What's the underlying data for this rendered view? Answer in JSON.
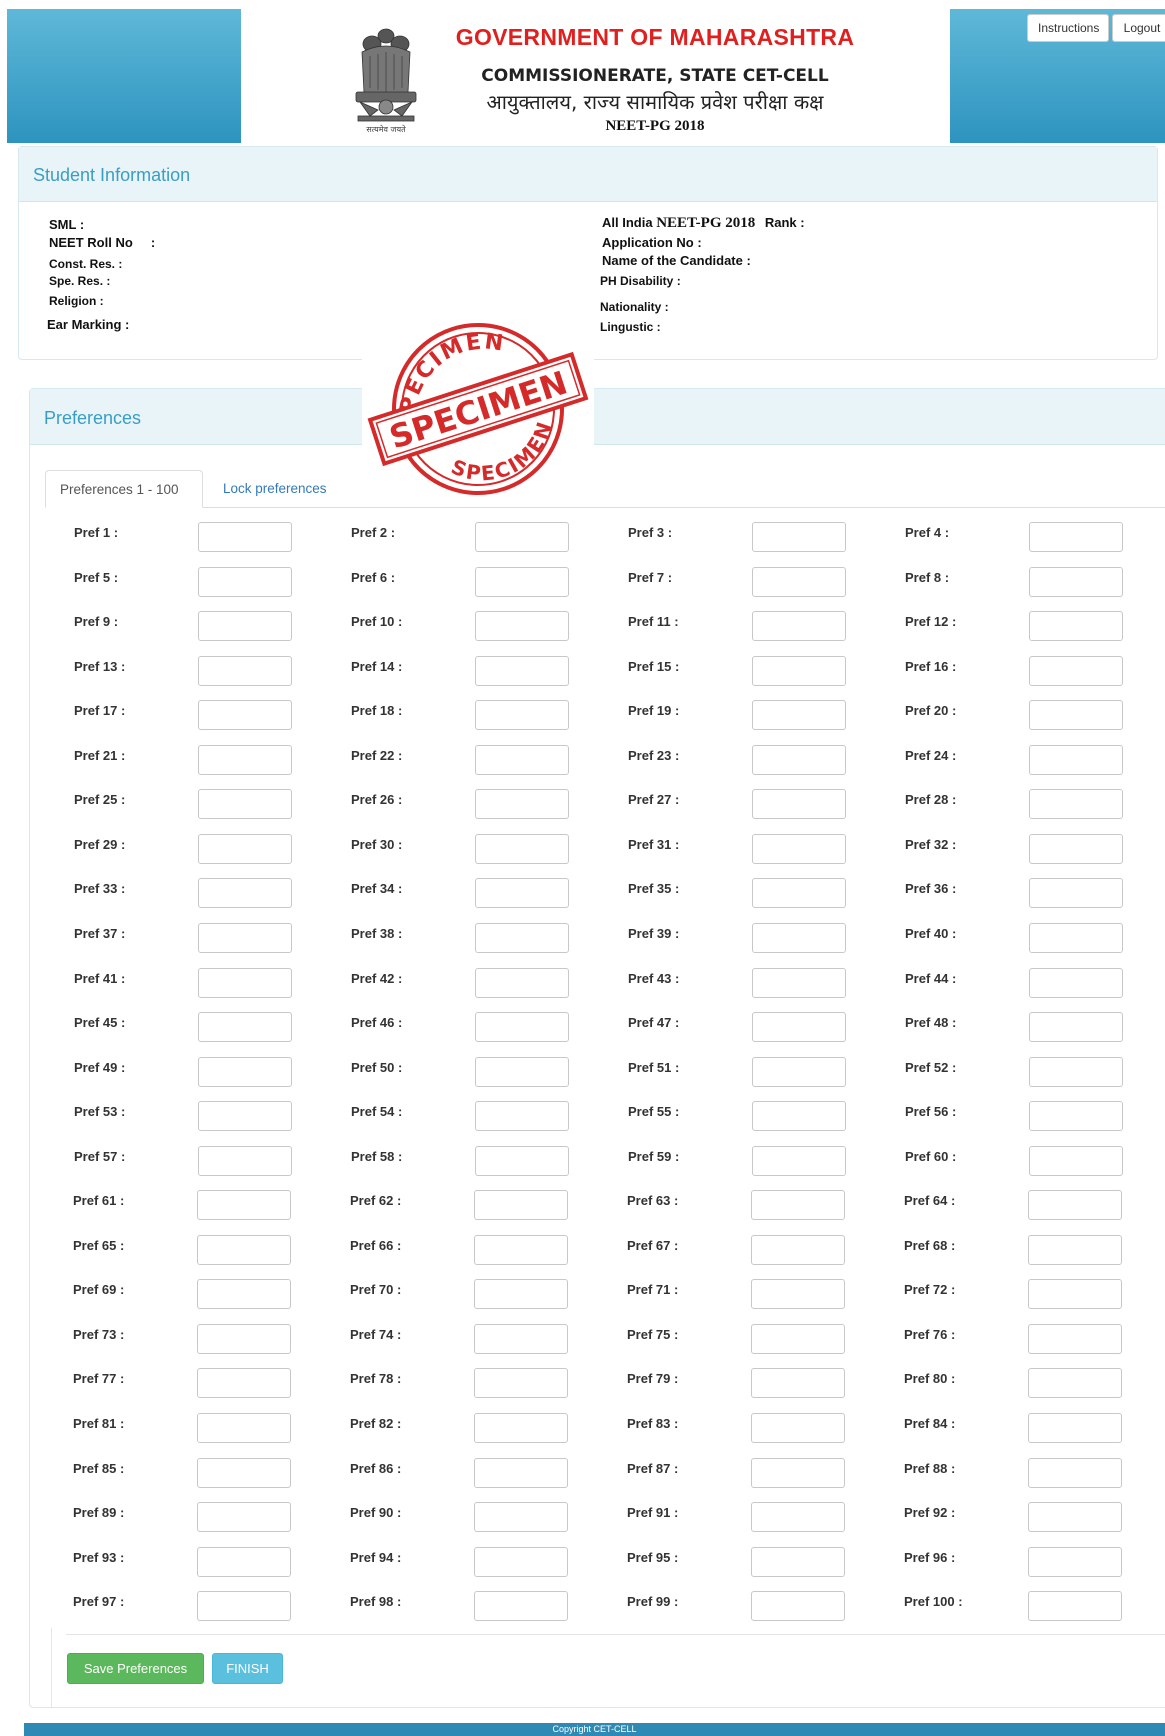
{
  "header": {
    "title": "GOVERNMENT OF MAHARASHTRA",
    "subtitle": "COMMISSIONERATE, STATE CET-CELL",
    "subtitle_hindi": "आयुक्तालय, राज्य सामायिक प्रवेश परीक्षा कक्ष",
    "exam": "NEET-PG 2018",
    "motto": "सत्यमेव जयते",
    "instructions_label": "Instructions",
    "logout_label": "Logout"
  },
  "student_info": {
    "title": "Student Information",
    "sml": "SML :",
    "roll_no": "NEET Roll No     :",
    "const_res": "Const. Res.  :",
    "spe_res": "Spe. Res. :",
    "religion": "Religion :",
    "ear_marking": "Ear Marking :",
    "rank_prefix": "All India",
    "rank_exam": "NEET-PG 2018",
    "rank_suffix": "Rank :",
    "application_no": "Application No :",
    "candidate_name": "Name of the Candidate :",
    "ph_disability": "PH Disability :",
    "nationality": "Nationality :",
    "lingustic": "Lingustic :"
  },
  "stamp": {
    "text_top": "SPECIMEN",
    "text_center": "SPECIMEN",
    "text_bottom": "SPECIMEN",
    "color": "#d42a2a"
  },
  "preferences": {
    "title": "Preferences",
    "tabs": [
      "Preferences 1 - 100",
      "Lock preferences"
    ],
    "count": 100,
    "label_prefix": "Pref ",
    "label_suffix": " :",
    "save_label": "Save Preferences",
    "finish_label": "FINISH"
  },
  "footer": {
    "copyright": "Copyright CET-CELL"
  },
  "colors": {
    "header_blue": "#2d94bf",
    "title_red": "#e0201f",
    "panel_title": "#3a9ec4",
    "save_green": "#5cb85c",
    "finish_blue": "#5bc0de"
  }
}
